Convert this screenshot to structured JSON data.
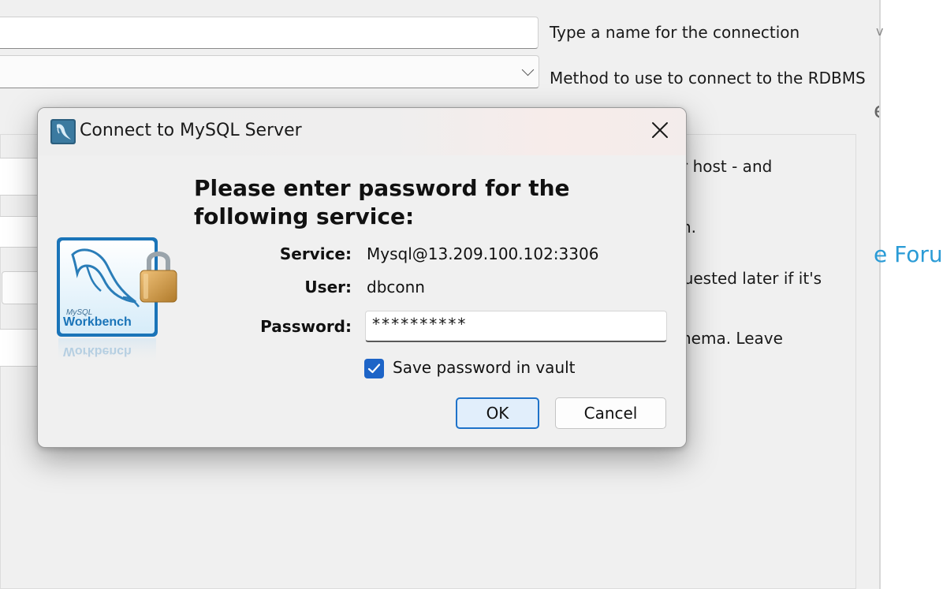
{
  "background": {
    "connection_name_hint": "Type a name for the connection",
    "method_hint": "Method to use to connect to the RDBMS",
    "side_heading_fragment": "er",
    "forum_link_fragment": "e Forur",
    "desc_line1": "r host - and",
    "desc_line2": "h.",
    "desc_line3": "quested later if it's",
    "desc_line4": "hema. Leave",
    "top_right_fragment": "v"
  },
  "dialog": {
    "title": "Connect to MySQL Server",
    "heading": "Please enter password for the following service:",
    "service_label": "Service:",
    "service_value": "Mysql@13.209.100.102:3306",
    "user_label": "User:",
    "user_value": "dbconn",
    "password_label": "Password:",
    "password_value": "**********",
    "save_password_label": "Save password in vault",
    "save_password_checked": true,
    "ok_label": "OK",
    "cancel_label": "Cancel",
    "logo_text_top": "MySQL",
    "logo_text_bottom": "Workbench",
    "logo_reflection": "Workbench"
  },
  "colors": {
    "accent": "#1d64c7",
    "link": "#2a9bd6",
    "ok_border": "#1e72c9",
    "ok_fill": "#e1eefb"
  },
  "icons": [
    "workbench-app-icon",
    "close-icon",
    "mysql-workbench-lock-logo",
    "checkmark-icon",
    "chevron-down-icon"
  ]
}
